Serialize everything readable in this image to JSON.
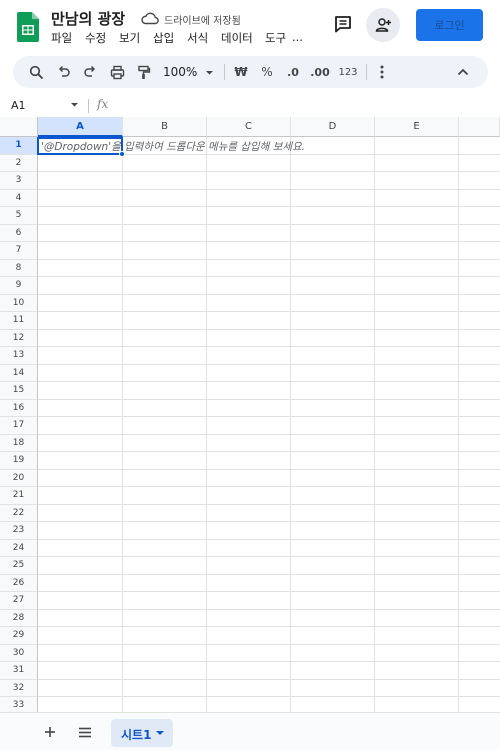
{
  "document": {
    "title": "만남의 광장",
    "save_status": "드라이브에 저장됨"
  },
  "menu": {
    "items": [
      "파일",
      "수정",
      "보기",
      "삽입",
      "서식",
      "데이터",
      "도구",
      "..."
    ]
  },
  "header_actions": {
    "login_label": "로그인"
  },
  "toolbar": {
    "zoom_label": "100%",
    "currency_label": "₩",
    "percent_label": "%",
    "decrease_decimal_label": ".0",
    "increase_decimal_label": ".00",
    "number_format_label": "123"
  },
  "formula_bar": {
    "cell_reference": "A1",
    "fx_label": "fx"
  },
  "grid": {
    "columns": [
      "A",
      "B",
      "C",
      "D",
      "E"
    ],
    "rows": [
      "1",
      "2",
      "3",
      "4",
      "5",
      "6",
      "7",
      "8",
      "9",
      "10",
      "11",
      "12",
      "13",
      "14",
      "15",
      "16",
      "17",
      "18",
      "19",
      "20",
      "21",
      "22",
      "23",
      "24",
      "25",
      "26",
      "27",
      "28",
      "29",
      "30",
      "31",
      "32",
      "33"
    ],
    "selected_cell": "A1",
    "cell_hint": "'@Dropdown'을 입력하여 드롭다운 메뉴를 삽입해 보세요."
  },
  "sheets": {
    "active_tab_label": "시트1"
  },
  "colors": {
    "accent_blue": "#1a73e8",
    "selection_blue": "#0b57d0",
    "toolbar_bg": "#eef2f9",
    "sheets_green": "#0f9d58"
  },
  "icons": {
    "logo": "google-sheets-logo",
    "cloud": "cloud-done-icon",
    "comment": "comment-icon",
    "share": "add-person-icon",
    "search": "search-icon",
    "undo": "undo-icon",
    "redo": "redo-icon",
    "print": "print-icon",
    "paint_format": "paint-format-icon",
    "more": "more-vertical-icon",
    "collapse": "chevron-up-icon",
    "add_sheet": "plus-icon",
    "all_sheets": "menu-icon"
  }
}
